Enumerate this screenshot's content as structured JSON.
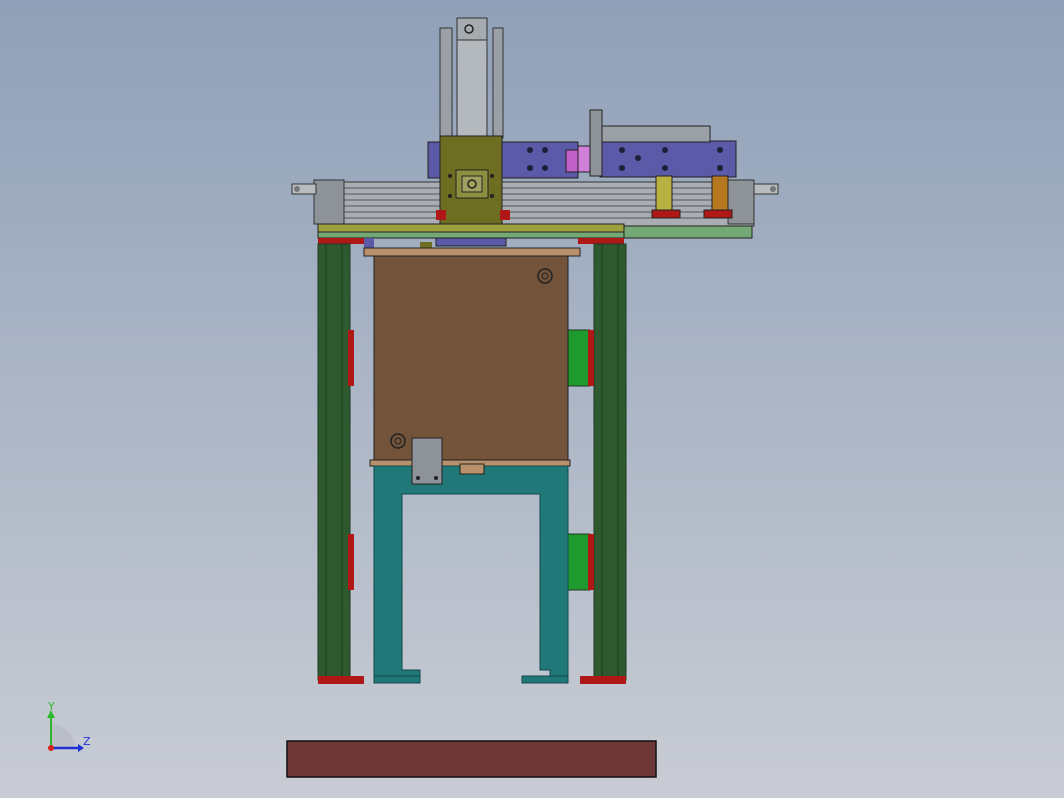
{
  "viewport": {
    "background_top": "#8fa0b8",
    "background_bottom": "#c9ccd4"
  },
  "triad": {
    "y_label": "Y",
    "z_label": "Z",
    "y_color": "#2db82d",
    "z_color": "#1f2fd6",
    "x_color": "#d62020"
  },
  "colors": {
    "frame_green": "#2f5a30",
    "frame_dark": "#1d3b1f",
    "teal": "#207878",
    "teal_dark": "#124a4a",
    "box_brown": "#735339",
    "box_tan": "#b8906c",
    "olive": "#6e6e22",
    "violet": "#5a5aa8",
    "pink": "#c060c8",
    "red": "#b01818",
    "grey": "#9aa0a6",
    "grey_dark": "#5c6166",
    "yellow": "#b8b040",
    "orange": "#b87820",
    "light_green": "#74a874",
    "bright_green": "#1e9a2e",
    "base_plate": "#6e3838"
  }
}
